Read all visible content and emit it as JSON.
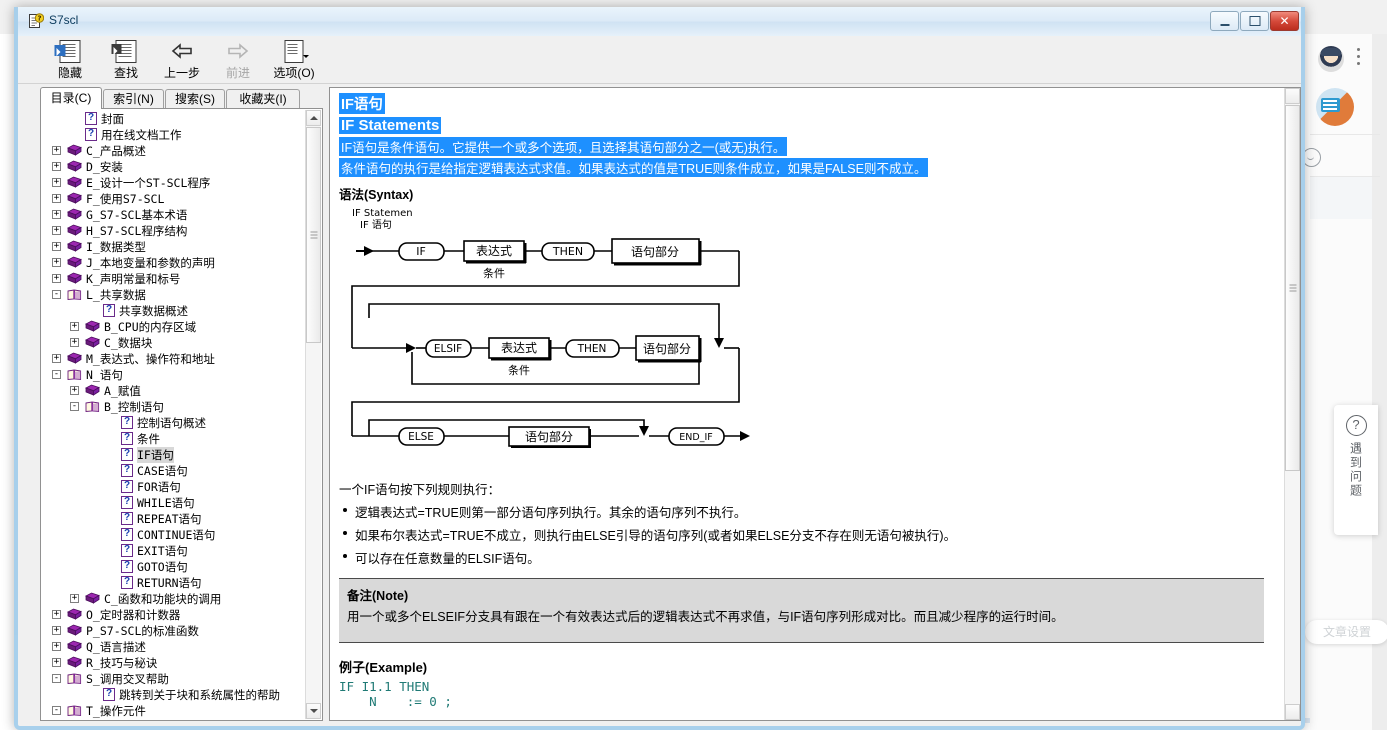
{
  "background": {
    "help_card": {
      "icon": "question-circle-icon",
      "label": "遇到问题"
    },
    "pill_label": "文章设置"
  },
  "window": {
    "title": "S7scl",
    "icon": "help-document-icon",
    "controls": {
      "minimize": "minimize-icon",
      "maximize": "maximize-icon",
      "close": "✕"
    }
  },
  "toolbar": {
    "buttons": [
      {
        "label": "隐藏",
        "icon": "hide-pane-icon",
        "disabled": false
      },
      {
        "label": "查找",
        "icon": "find-icon",
        "disabled": false
      },
      {
        "label": "上一步",
        "icon": "back-arrow-icon",
        "disabled": false
      },
      {
        "label": "前进",
        "icon": "forward-arrow-icon",
        "disabled": true
      },
      {
        "label": "选项(O)",
        "icon": "options-icon",
        "disabled": false
      }
    ]
  },
  "left_pane": {
    "tabs": [
      {
        "label": "目录(C)",
        "active": true
      },
      {
        "label": "索引(N)",
        "active": false
      },
      {
        "label": "搜索(S)",
        "active": false
      },
      {
        "label": "收藏夹(I)",
        "active": false
      }
    ],
    "tree": [
      {
        "label": "封面",
        "indent": 1,
        "icon": "topic-icon",
        "expander": ""
      },
      {
        "label": "用在线文档工作",
        "indent": 1,
        "icon": "topic-icon",
        "expander": ""
      },
      {
        "label": "C_产品概述",
        "indent": 0,
        "icon": "book-closed-icon",
        "expander": "+"
      },
      {
        "label": "D_安装",
        "indent": 0,
        "icon": "book-closed-icon",
        "expander": "+"
      },
      {
        "label": "E_设计一个ST-SCL程序",
        "indent": 0,
        "icon": "book-closed-icon",
        "expander": "+"
      },
      {
        "label": "F_使用S7-SCL",
        "indent": 0,
        "icon": "book-closed-icon",
        "expander": "+"
      },
      {
        "label": "G_S7-SCL基本术语",
        "indent": 0,
        "icon": "book-closed-icon",
        "expander": "+"
      },
      {
        "label": "H_S7-SCL程序结构",
        "indent": 0,
        "icon": "book-closed-icon",
        "expander": "+"
      },
      {
        "label": "I_数据类型",
        "indent": 0,
        "icon": "book-closed-icon",
        "expander": "+"
      },
      {
        "label": "J_本地变量和参数的声明",
        "indent": 0,
        "icon": "book-closed-icon",
        "expander": "+"
      },
      {
        "label": "K_声明常量和标号",
        "indent": 0,
        "icon": "book-closed-icon",
        "expander": "+"
      },
      {
        "label": "L_共享数据",
        "indent": 0,
        "icon": "book-open-icon",
        "expander": "-"
      },
      {
        "label": "共享数据概述",
        "indent": 2,
        "icon": "topic-icon",
        "expander": ""
      },
      {
        "label": "B_CPU的内存区域",
        "indent": 1,
        "icon": "book-closed-icon",
        "expander": "+"
      },
      {
        "label": "C_数据块",
        "indent": 1,
        "icon": "book-closed-icon",
        "expander": "+"
      },
      {
        "label": "M_表达式、操作符和地址",
        "indent": 0,
        "icon": "book-closed-icon",
        "expander": "+"
      },
      {
        "label": "N_语句",
        "indent": 0,
        "icon": "book-open-icon",
        "expander": "-"
      },
      {
        "label": "A_赋值",
        "indent": 1,
        "icon": "book-closed-icon",
        "expander": "+"
      },
      {
        "label": "B_控制语句",
        "indent": 1,
        "icon": "book-open-icon",
        "expander": "-"
      },
      {
        "label": "控制语句概述",
        "indent": 3,
        "icon": "topic-icon",
        "expander": ""
      },
      {
        "label": "条件",
        "indent": 3,
        "icon": "topic-icon",
        "expander": ""
      },
      {
        "label": "IF语句",
        "indent": 3,
        "icon": "topic-icon",
        "expander": "",
        "selected": true
      },
      {
        "label": "CASE语句",
        "indent": 3,
        "icon": "topic-icon",
        "expander": ""
      },
      {
        "label": "FOR语句",
        "indent": 3,
        "icon": "topic-icon",
        "expander": ""
      },
      {
        "label": "WHILE语句",
        "indent": 3,
        "icon": "topic-icon",
        "expander": ""
      },
      {
        "label": "REPEAT语句",
        "indent": 3,
        "icon": "topic-icon",
        "expander": ""
      },
      {
        "label": "CONTINUE语句",
        "indent": 3,
        "icon": "topic-icon",
        "expander": ""
      },
      {
        "label": "EXIT语句",
        "indent": 3,
        "icon": "topic-icon",
        "expander": ""
      },
      {
        "label": "GOTO语句",
        "indent": 3,
        "icon": "topic-icon",
        "expander": ""
      },
      {
        "label": "RETURN语句",
        "indent": 3,
        "icon": "topic-icon",
        "expander": ""
      },
      {
        "label": "C_函数和功能块的调用",
        "indent": 1,
        "icon": "book-closed-icon",
        "expander": "+"
      },
      {
        "label": "O_定时器和计数器",
        "indent": 0,
        "icon": "book-closed-icon",
        "expander": "+"
      },
      {
        "label": "P_S7-SCL的标准函数",
        "indent": 0,
        "icon": "book-closed-icon",
        "expander": "+"
      },
      {
        "label": "Q_语言描述",
        "indent": 0,
        "icon": "book-closed-icon",
        "expander": "+"
      },
      {
        "label": "R_技巧与秘诀",
        "indent": 0,
        "icon": "book-closed-icon",
        "expander": "+"
      },
      {
        "label": "S_调用交叉帮助",
        "indent": 0,
        "icon": "book-open-icon",
        "expander": "-"
      },
      {
        "label": "跳转到关于块和系统属性的帮助",
        "indent": 2,
        "icon": "topic-icon",
        "expander": ""
      },
      {
        "label": "T_操作元件",
        "indent": 0,
        "icon": "book-open-icon",
        "expander": "-"
      }
    ]
  },
  "document": {
    "title_cn": "IF语句",
    "title_en": "IF Statements",
    "intro_1": "IF语句是条件语句。它提供一个或多个选项，且选择其语句部分之一(或无)执行。",
    "intro_2": "条件语句的执行是给指定逻辑表达式求值。如果表达式的值是TRUE则条件成立，如果是FALSE则不成立。",
    "syntax_heading": "语法(Syntax)",
    "diagram": {
      "caption_en": "IF Statemen",
      "caption_cn": "IF 语句",
      "row1": {
        "keyword": "IF",
        "expr": "表达式",
        "expr_sub": "条件",
        "then": "THEN",
        "stmt": "语句部分"
      },
      "row2": {
        "keyword": "ELSIF",
        "expr": "表达式",
        "expr_sub": "条件",
        "then": "THEN",
        "stmt": "语句部分"
      },
      "row3": {
        "keyword": "ELSE",
        "stmt": "语句部分",
        "end": "END_IF"
      }
    },
    "rules_intro": "一个IF语句按下列规则执行：",
    "rules": [
      "逻辑表达式=TRUE则第一部分语句序列执行。其余的语句序列不执行。",
      "如果布尔表达式=TRUE不成立，则执行由ELSE引导的语句序列(或者如果ELSE分支不存在则无语句被执行)。",
      "可以存在任意数量的ELSIF语句。"
    ],
    "note_title": "备注(Note)",
    "note_body": "用一个或多个ELSEIF分支具有跟在一个有效表达式后的逻辑表达式不再求值，与IF语句序列形成对比。而且减少程序的运行时间。",
    "example_heading": "例子(Example)",
    "example_code": "IF I1.1 THEN\n    N    := 0 ;"
  }
}
